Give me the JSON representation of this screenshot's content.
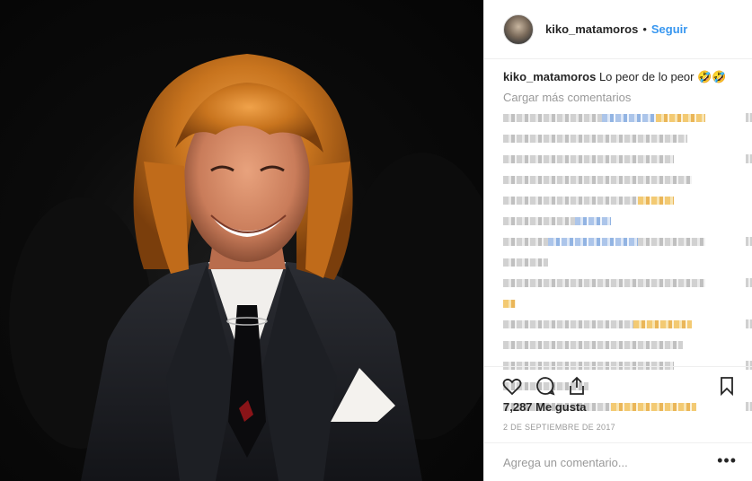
{
  "post": {
    "username": "kiko_matamoros",
    "follow_label": "Seguir",
    "separator": "•",
    "caption_user": "kiko_matamoros",
    "caption_text": "Lo peor de lo peor 🤣🤣",
    "load_more": "Cargar más comentarios",
    "likes": "7,287 Me gusta",
    "date": "2 DE SEPTIEMBRE DE 2017",
    "comment_placeholder": "Agrega un comentario...",
    "options": "•••"
  },
  "icons": [
    "heart-icon",
    "comment-icon",
    "share-icon",
    "bookmark-icon"
  ],
  "colors": {
    "link_blue": "#3897f0",
    "muted": "#999999",
    "text": "#262626",
    "border": "#efefef"
  }
}
